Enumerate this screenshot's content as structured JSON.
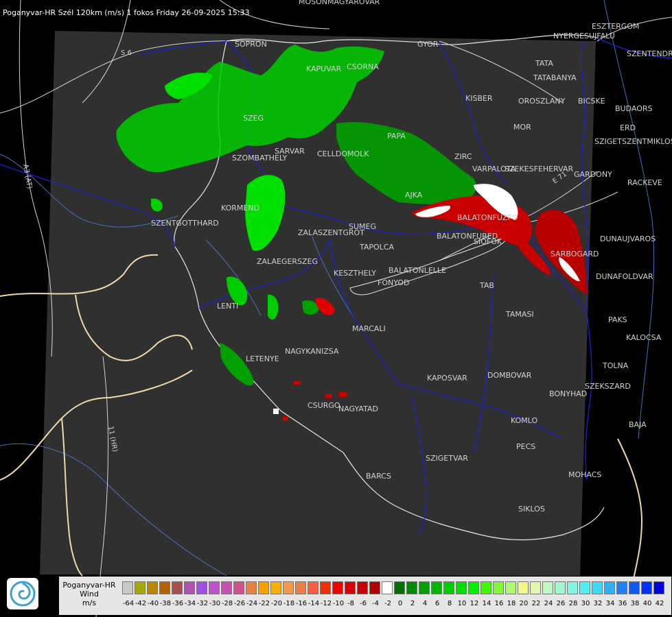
{
  "header": {
    "title": "Poganyvar-HR Szél 120km (m/s) 1 fokos Friday 26-09-2025 15:33"
  },
  "map": {
    "background_color": "#000000",
    "domain_color": "#303030",
    "border_color": "#1a1acc",
    "coast_color": "#ffffff",
    "foreign_border_color": "#f0d8a8",
    "road_color": "#dcdcdc",
    "river_color": "#5078c8",
    "road_labels": [
      "S 6",
      "A3 (AT)",
      "11 (HR)",
      "E 71"
    ],
    "cities": [
      "MOSONMAGYAROVAR",
      "ESZTERGOM",
      "NYERGESUJFALU",
      "SZENTENDRE",
      "SOPRON",
      "GYOR",
      "TATA",
      "TATABANYA",
      "KAPUVAR",
      "CSORNA",
      "KISBER",
      "OROSZLANY",
      "BICSKE",
      "BUDAORS",
      "ERD",
      "SZIGETSZENTMIKLOS",
      "MOR",
      "PAPA",
      "SZEG",
      "SARVAR",
      "CELLDOMOLK",
      "ZIRC",
      "SZOMBATHELY",
      "VARPALOTA",
      "SZEKESFEHERVAR",
      "GARDONY",
      "RACKEVE",
      "AJKA",
      "KORMEND",
      "SZENTGOTTHARD",
      "BALATONFUZFO",
      "SUMEG",
      "ZALASZENTGROT",
      "BALATONFURED",
      "SIOFOK",
      "DUNAUJVAROS",
      "TAPOLCA",
      "SARBOGARD",
      "ZALAEGERSZEG",
      "BALATONLELLE",
      "KESZTHELY",
      "FONYOD",
      "DUNAFOLDVAR",
      "TAB",
      "LENTI",
      "TAMASI",
      "PAKS",
      "MARCALI",
      "KALOCSA",
      "NAGYKANIZSA",
      "LETENYE",
      "TOLNA",
      "KAPOSVAR",
      "DOMBOVAR",
      "SZEKSZARD",
      "BONYHAD",
      "CSURGO",
      "NAGYATAD",
      "KOMLO",
      "BAJA",
      "PECS",
      "SZIGETVAR",
      "MOHACS",
      "BARCS",
      "SIKLOS"
    ]
  },
  "legend": {
    "title_line1": "Poganyvar-HR",
    "title_line2": "Wind",
    "title_line3": "m/s",
    "ticks": [
      "-64",
      "-42",
      "-40",
      "-38",
      "-36",
      "-34",
      "-32",
      "-30",
      "-28",
      "-26",
      "-24",
      "-22",
      "-20",
      "-18",
      "-16",
      "-14",
      "-12",
      "-10",
      "-8",
      "-6",
      "-4",
      "-2",
      "0",
      "2",
      "4",
      "6",
      "8",
      "10",
      "12",
      "14",
      "16",
      "18",
      "20",
      "22",
      "24",
      "26",
      "28",
      "30",
      "32",
      "34",
      "36",
      "38",
      "40",
      "42"
    ],
    "colors": [
      "#c8c8c8",
      "#a8a800",
      "#b88800",
      "#b86000",
      "#a85050",
      "#b050b0",
      "#a050e0",
      "#c050d0",
      "#c850b0",
      "#d05088",
      "#e88040",
      "#f8a000",
      "#f8b000",
      "#f89848",
      "#e88048",
      "#f86040",
      "#f03000",
      "#f00000",
      "#d80000",
      "#c80000",
      "#b00000",
      "#ffffff",
      "#007000",
      "#008800",
      "#00a000",
      "#00b800",
      "#00cc00",
      "#00e000",
      "#00f000",
      "#40f800",
      "#80f840",
      "#b0f870",
      "#f0f888",
      "#e0f8b0",
      "#c0f8c0",
      "#a0f8d0",
      "#80f8e0",
      "#50f0f0",
      "#40d8f8",
      "#30b0f8",
      "#2080f8",
      "#1058f8",
      "#0030f8",
      "#0000d8"
    ],
    "logo_icon": "storm-logo-icon"
  }
}
